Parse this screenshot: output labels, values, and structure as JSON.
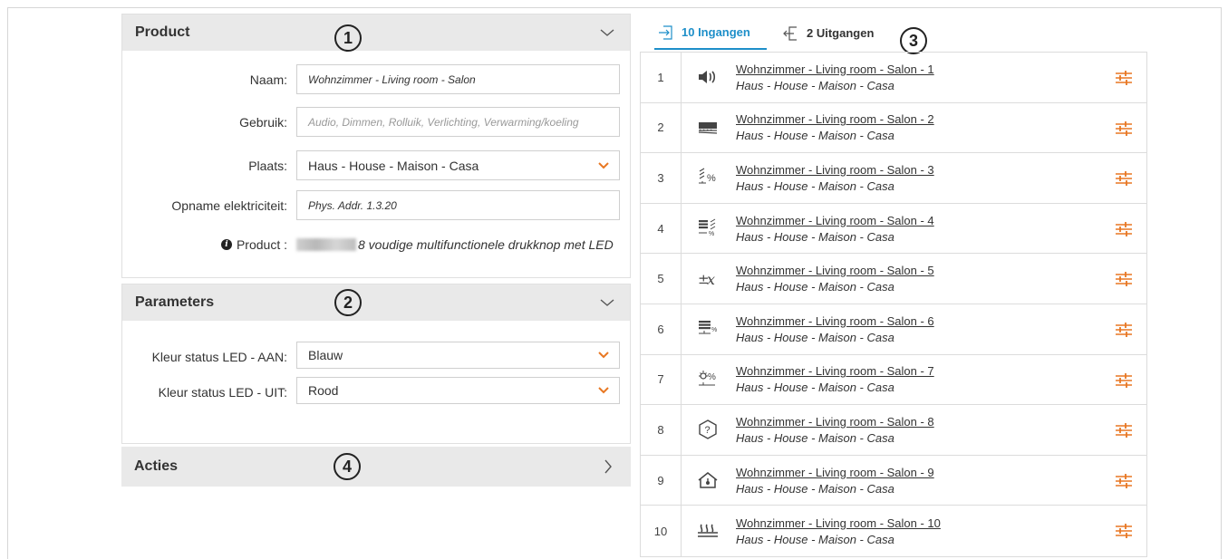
{
  "product": {
    "title": "Product",
    "badge": "1",
    "fields": {
      "naam_label": "Naam:",
      "naam_value": "Wohnzimmer - Living room - Salon",
      "gebruik_label": "Gebruik:",
      "gebruik_placeholder": "Audio, Dimmen, Rolluik, Verlichting, Verwarming/koeling",
      "plaats_label": "Plaats:",
      "plaats_value": "Haus - House - Maison - Casa",
      "opname_label": "Opname elektriciteit:",
      "opname_value": "Phys. Addr. 1.3.20"
    },
    "info_label": "Product :",
    "info_value": "8 voudige multifunctionele drukknop met LED"
  },
  "parameters": {
    "title": "Parameters",
    "badge": "2",
    "led_on_label": "Kleur status LED - AAN:",
    "led_on_value": "Blauw",
    "led_off_label": "Kleur status LED - UIT:",
    "led_off_value": "Rood"
  },
  "acties": {
    "title": "Acties",
    "badge": "4"
  },
  "tabs": {
    "inputs_label": "10 Ingangen",
    "outputs_label": "2 Uitgangen",
    "badge": "3"
  },
  "colors": {
    "accent_blue": "#1e8fc9",
    "accent_orange": "#e87722"
  },
  "inputs": [
    {
      "num": "1",
      "icon": "speaker-icon",
      "name": "Wohnzimmer - Living room - Salon - 1",
      "location": "Haus - House - Maison - Casa"
    },
    {
      "num": "2",
      "icon": "blind-icon",
      "name": "Wohnzimmer - Living room - Salon - 2",
      "location": "Haus - House - Maison - Casa"
    },
    {
      "num": "3",
      "icon": "blind-percent-icon",
      "name": "Wohnzimmer - Living room - Salon - 3",
      "location": "Haus - House - Maison - Casa"
    },
    {
      "num": "4",
      "icon": "shutter-percent-icon",
      "name": "Wohnzimmer - Living room - Salon - 4",
      "location": "Haus - House - Maison - Casa"
    },
    {
      "num": "5",
      "icon": "plus-minus-x-icon",
      "name": "Wohnzimmer - Living room - Salon - 5",
      "location": "Haus - House - Maison - Casa"
    },
    {
      "num": "6",
      "icon": "shutter-level-icon",
      "name": "Wohnzimmer - Living room - Salon - 6",
      "location": "Haus - House - Maison - Casa"
    },
    {
      "num": "7",
      "icon": "dimmer-percent-icon",
      "name": "Wohnzimmer - Living room - Salon - 7",
      "location": "Haus - House - Maison - Casa"
    },
    {
      "num": "8",
      "icon": "question-icon",
      "name": "Wohnzimmer - Living room - Salon - 8",
      "location": "Haus - House - Maison - Casa"
    },
    {
      "num": "9",
      "icon": "house-temperature-icon",
      "name": "Wohnzimmer - Living room - Salon - 9",
      "location": "Haus - House - Maison - Casa"
    },
    {
      "num": "10",
      "icon": "heating-icon",
      "name": "Wohnzimmer - Living room - Salon - 10",
      "location": "Haus - House - Maison - Casa"
    }
  ]
}
